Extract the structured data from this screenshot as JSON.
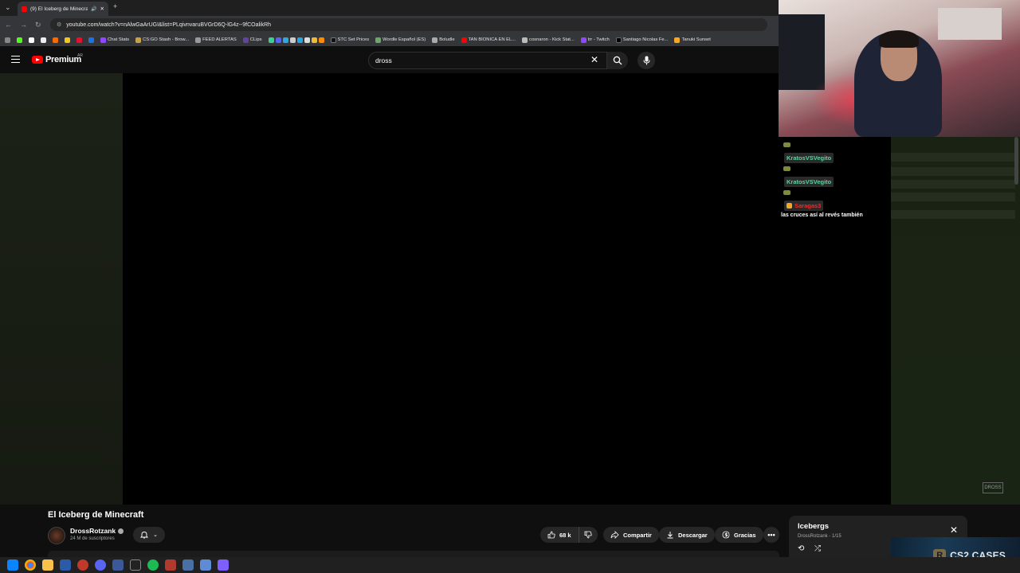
{
  "browser": {
    "tab_title": "(9) El Iceberg de Minecraft",
    "url": "youtube.com/watch?v=nAlwGaArUGI&list=PLqivnvaruBVGrD6Q-lG4z--9fCOalikRh",
    "bookmarks": [
      "Chat Stats",
      "CS:GO Stash - Brow...",
      "FEED ALERTAS",
      "CLips",
      "STC Set Prices",
      "Wordle Español (ES)",
      "Boludle",
      "TAN BIONICA EN EL...",
      "cosnaron - Kick Stat...",
      "trr - Twitch",
      "Santiago Nicolas Fe...",
      "Tanuki Sunset"
    ]
  },
  "youtube": {
    "logo_text": "Premium",
    "region": "AR",
    "search_value": "dross"
  },
  "chat": {
    "messages": [
      {
        "user": "KratosVSVegito",
        "color": "#5dd39e"
      },
      {
        "user": "KratosVSVegito",
        "color": "#5dd39e"
      },
      {
        "user": "Saragas3",
        "color": "#e0312f",
        "text": "las cruces así al revés también"
      }
    ]
  },
  "video": {
    "title": "El Iceberg de Minecraft",
    "channel": "DrossRotzank",
    "subscribers": "24 M de suscriptores",
    "likes": "68 k",
    "share_label": "Compartir",
    "download_label": "Descargar",
    "thanks_label": "Gracias"
  },
  "playlist": {
    "title": "Icebergs",
    "subtitle": "DrossRotzank - 1/15"
  },
  "overlay": {
    "text": "CS2 CASES",
    "watermark": "DROSS"
  }
}
